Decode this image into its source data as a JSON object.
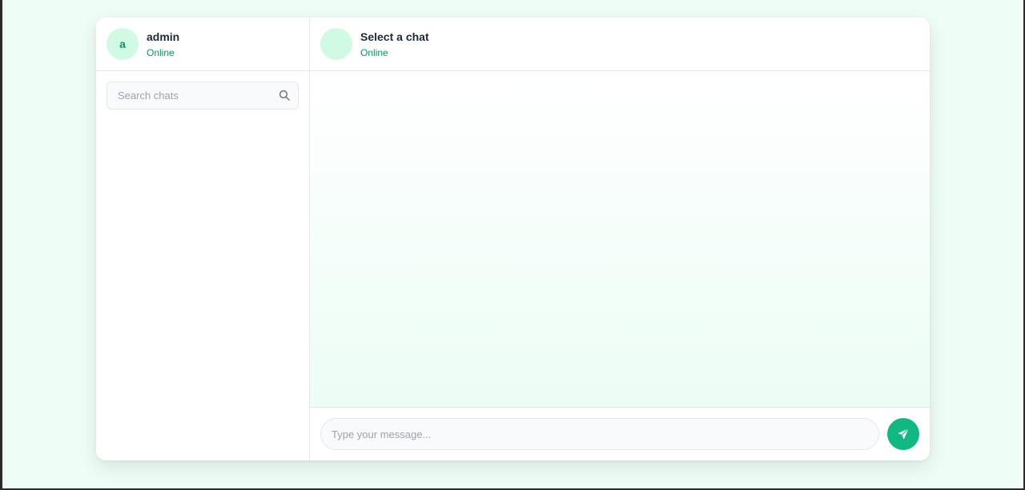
{
  "sidebar": {
    "user": {
      "avatar_initial": "a",
      "name": "admin",
      "status": "Online"
    },
    "search": {
      "placeholder": "Search chats",
      "value": "",
      "icon": "search-icon"
    },
    "chats": []
  },
  "chat": {
    "header": {
      "avatar_initial": "",
      "title": "Select a chat",
      "status": "Online"
    },
    "messages": [],
    "composer": {
      "placeholder": "Type your message...",
      "value": "",
      "send_icon": "send-icon"
    }
  },
  "colors": {
    "accent": "#10b981",
    "accent_dark": "#059669",
    "avatar_bg": "#d1fae5",
    "page_bg": "#eefdf5"
  }
}
